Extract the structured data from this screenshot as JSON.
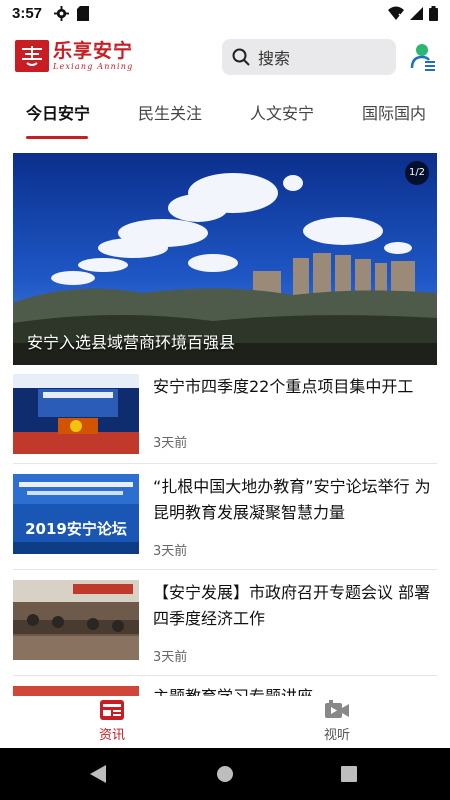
{
  "status_bar": {
    "time": "3:57"
  },
  "header": {
    "logo_title": "乐享安宁",
    "logo_subtitle": "Lexiang Anning",
    "search_label": "搜索"
  },
  "tabs": [
    {
      "label": "今日安宁",
      "active": true
    },
    {
      "label": "民生关注",
      "active": false
    },
    {
      "label": "人文安宁",
      "active": false
    },
    {
      "label": "国际国内",
      "active": false
    }
  ],
  "banner": {
    "caption": "安宁入选县域营商环境百强县",
    "counter": "1/2"
  },
  "news": [
    {
      "title": "安宁市四季度22个重点项目集中开工",
      "time": "3天前"
    },
    {
      "title": "“扎根中国大地办教育”安宁论坛举行 为昆明教育发展凝聚智慧力量",
      "time": "3天前",
      "thumb_text": "2019安宁论坛"
    },
    {
      "title": "【安宁发展】市政府召开专题会议 部署四季度经济工作",
      "time": "3天前"
    },
    {
      "title": "主题教育学习专题讲座",
      "time": ""
    }
  ],
  "bottom_nav": [
    {
      "label": "资讯",
      "icon": "news-icon",
      "active": true
    },
    {
      "label": "视听",
      "icon": "video-icon",
      "active": false
    }
  ],
  "colors": {
    "brand_red": "#c81d23",
    "inactive_gray": "#888888"
  }
}
